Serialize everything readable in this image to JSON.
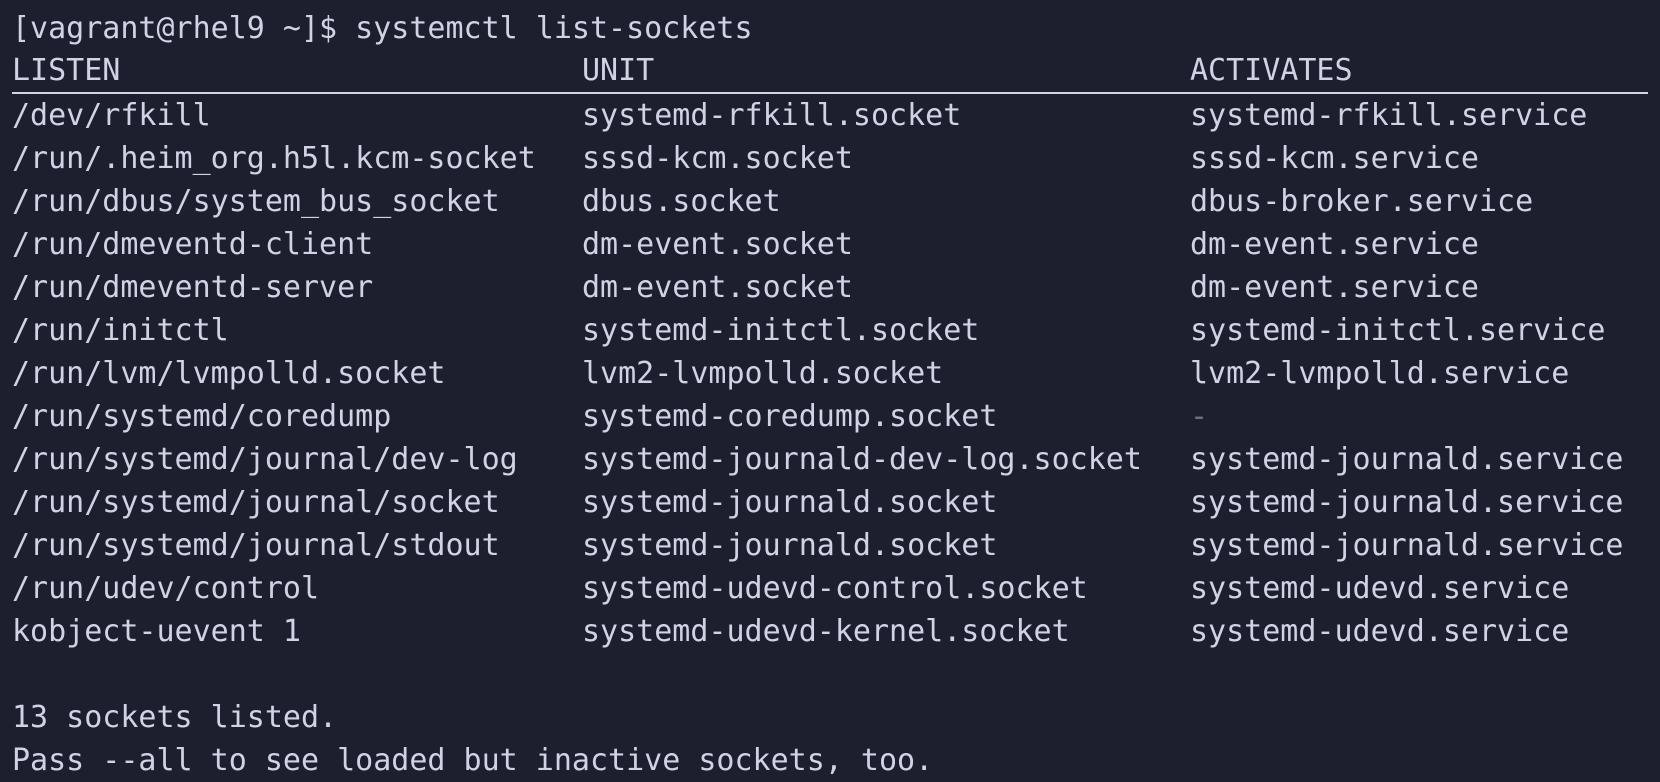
{
  "terminal": {
    "prompt": "[vagrant@rhel9 ~]$ ",
    "command": "systemctl list-sockets",
    "columns": [
      "LISTEN",
      "UNIT",
      "ACTIVATES"
    ],
    "rows": [
      {
        "listen": "/dev/rfkill",
        "unit": "systemd-rfkill.socket",
        "activates": "systemd-rfkill.service"
      },
      {
        "listen": "/run/.heim_org.h5l.kcm-socket",
        "unit": "sssd-kcm.socket",
        "activates": "sssd-kcm.service"
      },
      {
        "listen": "/run/dbus/system_bus_socket",
        "unit": "dbus.socket",
        "activates": "dbus-broker.service"
      },
      {
        "listen": "/run/dmeventd-client",
        "unit": "dm-event.socket",
        "activates": "dm-event.service"
      },
      {
        "listen": "/run/dmeventd-server",
        "unit": "dm-event.socket",
        "activates": "dm-event.service"
      },
      {
        "listen": "/run/initctl",
        "unit": "systemd-initctl.socket",
        "activates": "systemd-initctl.service"
      },
      {
        "listen": "/run/lvm/lvmpolld.socket",
        "unit": "lvm2-lvmpolld.socket",
        "activates": "lvm2-lvmpolld.service"
      },
      {
        "listen": "/run/systemd/coredump",
        "unit": "systemd-coredump.socket",
        "activates": "-"
      },
      {
        "listen": "/run/systemd/journal/dev-log",
        "unit": "systemd-journald-dev-log.socket",
        "activates": "systemd-journald.service"
      },
      {
        "listen": "/run/systemd/journal/socket",
        "unit": "systemd-journald.socket",
        "activates": "systemd-journald.service"
      },
      {
        "listen": "/run/systemd/journal/stdout",
        "unit": "systemd-journald.socket",
        "activates": "systemd-journald.service"
      },
      {
        "listen": "/run/udev/control",
        "unit": "systemd-udevd-control.socket",
        "activates": "systemd-udevd.service"
      },
      {
        "listen": "kobject-uevent 1",
        "unit": "systemd-udevd-kernel.socket",
        "activates": "systemd-udevd.service"
      }
    ],
    "summary": "13 sockets listed.",
    "hint": "Pass --all to see loaded but inactive sockets, too."
  },
  "colors": {
    "background": "#1e1f2e",
    "foreground": "#cfd3e6",
    "muted": "#6c6f85"
  }
}
